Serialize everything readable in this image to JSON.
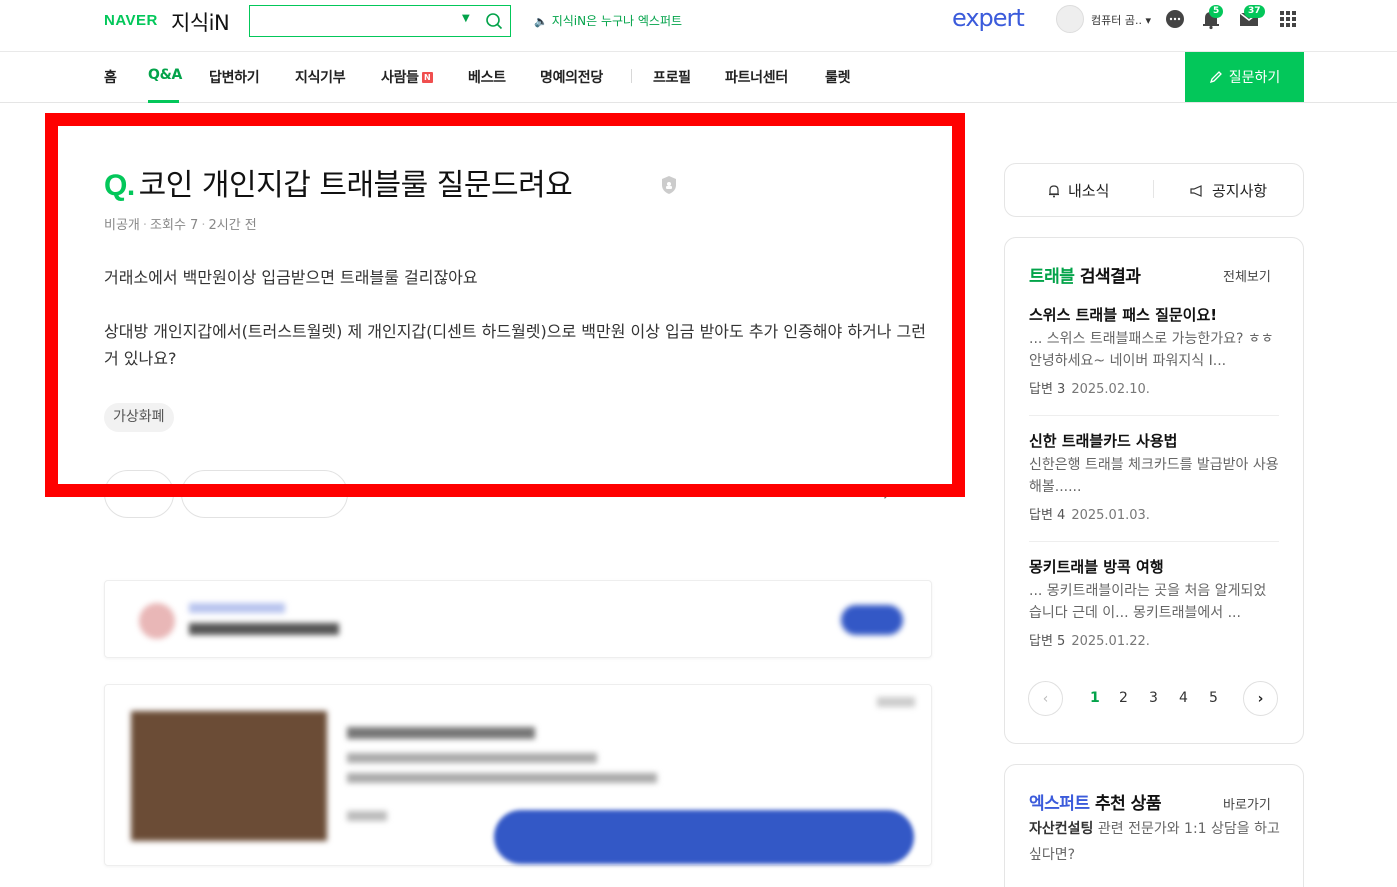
{
  "header": {
    "logo_naver": "NAVER",
    "logo_kin": "지식iN",
    "search_placeholder": "",
    "notice": "지식iN은 누구나 엑스퍼트",
    "expert_logo": "expert",
    "username": "컴퓨터 곰..",
    "alarm_count": "5",
    "mail_count": "37"
  },
  "nav": {
    "items": [
      "홈",
      "Q&A",
      "답변하기",
      "지식기부",
      "사람들",
      "베스트",
      "명예의전당",
      "프로필",
      "파트너센터",
      "룰렛"
    ],
    "active": "Q&A",
    "new_badge": "N",
    "ask_button": "질문하기"
  },
  "question": {
    "q_mark": "Q.",
    "title": "코인 개인지갑 트래블룰 질문드려요",
    "meta_visibility": "비공개",
    "meta_views": "조회수 7",
    "meta_time": "2시간 전",
    "body_p1": "거래소에서 백만원이상 입금받으면 트래블룰 걸리잖아요",
    "body_p2": "상대방 개인지갑에서(트러스트월렛) 제 개인지갑(디센트 하드월렛)으로 백만원 이상 입금 받아도 추가 인증해야 하거나 그런거 있나요?",
    "tag": "가상화폐"
  },
  "sidebar": {
    "my_news": "내소식",
    "notice": "공지사항",
    "search_keyword": "트래블",
    "search_title_suffix": " 검색결과",
    "view_all": "전체보기",
    "results": [
      {
        "title": "스위스 트래블 패스 질문이요!",
        "snippet": "... 스위스 트래블패스로 가능한가요? ㅎㅎ 안녕하세요~ 네이버 파워지식 I...",
        "answers": "답변 3",
        "date": "2025.02.10."
      },
      {
        "title": "신한 트래블카드 사용법",
        "snippet": "신한은행 트래블 체크카드를 발급받아 사용해볼......",
        "answers": "답변 4",
        "date": "2025.01.03."
      },
      {
        "title": "몽키트래블 방콕 여행",
        "snippet": "... 몽키트래블이라는 곳을 처음 알게되었습니다 근데 이... 몽키트래블에서 ...",
        "answers": "답변 5",
        "date": "2025.01.22."
      }
    ],
    "pages": [
      "1",
      "2",
      "3",
      "4",
      "5"
    ],
    "expert_keyword": "엑스퍼트",
    "expert_title_suffix": " 추천 상품",
    "go": "바로가기",
    "expert_bold": "자산컨설팅",
    "expert_text": " 관련 전문가와 1:1 상담을 하고 싶다면?"
  },
  "colors": {
    "brand_green": "#03c75a",
    "expert_blue": "#3b5bdb",
    "highlight_red": "#ff0000"
  }
}
